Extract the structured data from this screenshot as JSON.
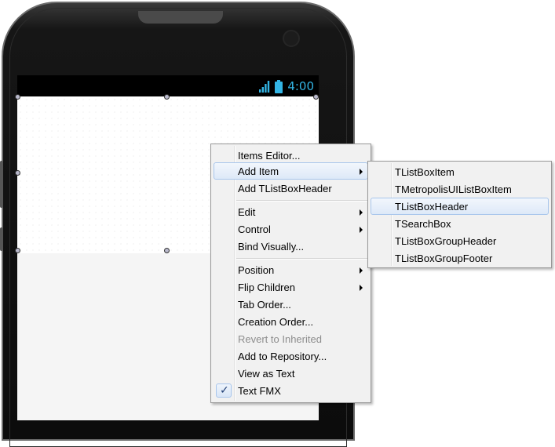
{
  "status_bar": {
    "time": "4:00",
    "signal_icon": "signal-bars-icon",
    "battery_icon": "battery-icon",
    "accent_color": "#33b5e5"
  },
  "context_menu": {
    "items": [
      {
        "label": "Items Editor...",
        "has_submenu": false,
        "disabled": false
      },
      {
        "label": "Add Item",
        "has_submenu": true,
        "disabled": false,
        "highlighted": true
      },
      {
        "label": "Add TListBoxHeader",
        "has_submenu": false,
        "disabled": false
      },
      {
        "label": "Edit",
        "has_submenu": true,
        "disabled": false
      },
      {
        "label": "Control",
        "has_submenu": true,
        "disabled": false
      },
      {
        "label": "Bind Visually...",
        "has_submenu": false,
        "disabled": false
      },
      {
        "label": "Position",
        "has_submenu": true,
        "disabled": false
      },
      {
        "label": "Flip Children",
        "has_submenu": true,
        "disabled": false
      },
      {
        "label": "Tab Order...",
        "has_submenu": false,
        "disabled": false
      },
      {
        "label": "Creation Order...",
        "has_submenu": false,
        "disabled": false
      },
      {
        "label": "Revert to Inherited",
        "has_submenu": false,
        "disabled": true
      },
      {
        "label": "Add to Repository...",
        "has_submenu": false,
        "disabled": false
      },
      {
        "label": "View as Text",
        "has_submenu": false,
        "disabled": false
      },
      {
        "label": "Text FMX",
        "has_submenu": false,
        "disabled": false,
        "checked": true
      }
    ],
    "check_glyph": "✓"
  },
  "submenu": {
    "items": [
      {
        "label": "TListBoxItem"
      },
      {
        "label": "TMetropolisUIListBoxItem"
      },
      {
        "label": "TListBoxHeader",
        "highlighted": true
      },
      {
        "label": "TSearchBox"
      },
      {
        "label": "TListBoxGroupHeader"
      },
      {
        "label": "TListBoxGroupFooter"
      }
    ]
  }
}
